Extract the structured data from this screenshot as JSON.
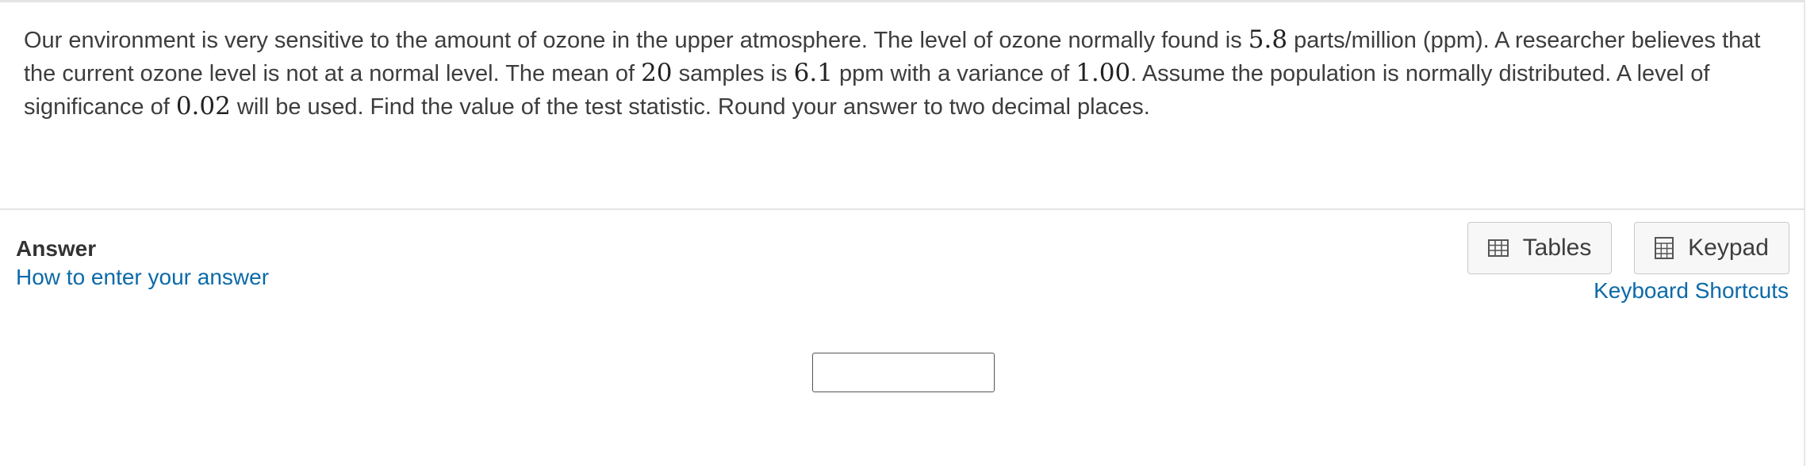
{
  "question": {
    "t1": "Our environment is very sensitive to the amount of ozone in the upper atmosphere. The level of ozone normally found is ",
    "v1": "5.8",
    "t2": " parts/million (ppm). A researcher believes that the current ozone level is not at a normal level. The mean of ",
    "v2": "20",
    "t3": " samples is ",
    "v3": "6.1",
    "t4": " ppm with a variance of ",
    "v4": "1.00",
    "t5": ". Assume the population is normally distributed. A level of significance of ",
    "v5": "0.02",
    "t6": " will be used. Find the value of the test statistic. Round your answer to two decimal places."
  },
  "answer": {
    "label": "Answer",
    "how_to_link": "How to enter your answer",
    "input_value": ""
  },
  "toolbar": {
    "tables_label": "Tables",
    "keypad_label": "Keypad",
    "shortcuts_link": "Keyboard Shortcuts"
  },
  "icons": {
    "tables": "table-grid-icon",
    "keypad": "calculator-keypad-icon"
  },
  "colors": {
    "link": "#0b6aa8",
    "text": "#3d3d3d",
    "button_bg": "#f7f7f7",
    "border": "#c9c9c9"
  }
}
